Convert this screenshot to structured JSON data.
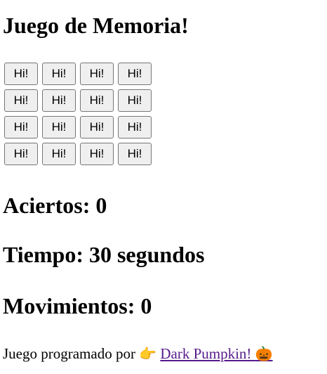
{
  "title": "Juego de Memoria!",
  "grid": {
    "cards": [
      "Hi!",
      "Hi!",
      "Hi!",
      "Hi!",
      "Hi!",
      "Hi!",
      "Hi!",
      "Hi!",
      "Hi!",
      "Hi!",
      "Hi!",
      "Hi!",
      "Hi!",
      "Hi!",
      "Hi!",
      "Hi!"
    ]
  },
  "stats": {
    "aciertos": "Aciertos: 0",
    "tiempo": "Tiempo: 30 segundos",
    "movimientos": "Movimientos: 0"
  },
  "footer": {
    "text": "Juego programado por",
    "pointer_emoji": "👉",
    "link_text": "Dark Pumpkin!",
    "pumpkin_emoji": "🎃"
  }
}
